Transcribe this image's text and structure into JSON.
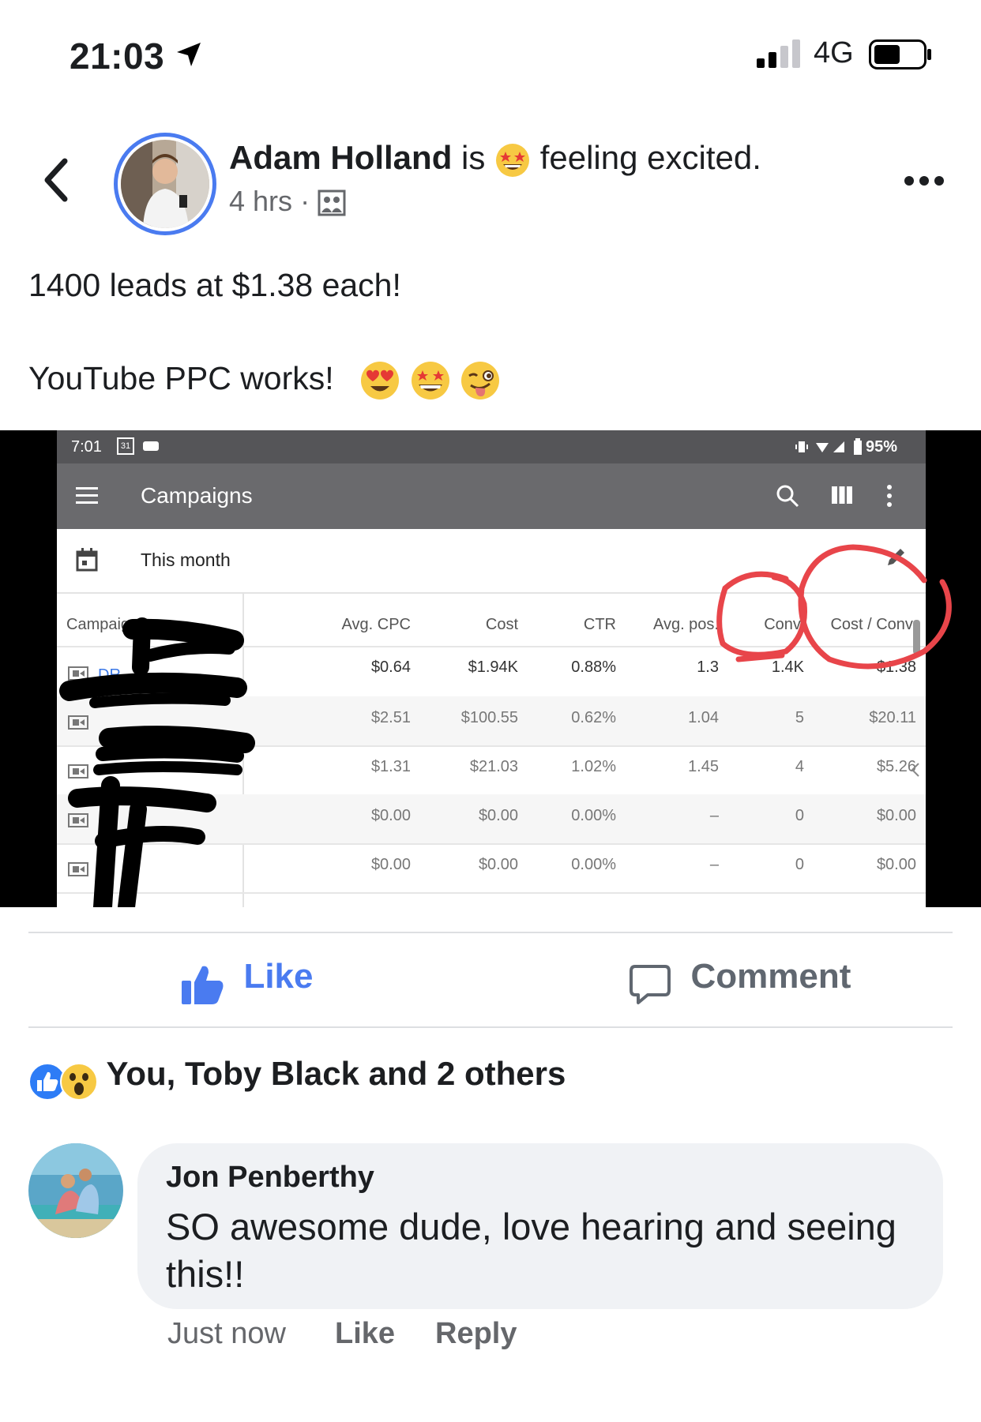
{
  "status_bar": {
    "time": "21:03",
    "network": "4G"
  },
  "post": {
    "author": "Adam Holland",
    "is": "is",
    "feeling": "feeling excited.",
    "time": "4 hrs",
    "separator": "·",
    "text_line1": "1400 leads at $1.38 each!",
    "text_line2": "YouTube PPC works!"
  },
  "embedded": {
    "status_time": "7:01",
    "calendar_day": "31",
    "battery": "95%",
    "toolbar_title": "Campaigns",
    "date_range": "This month",
    "headers": [
      "Campaign",
      "Avg. CPC",
      "Cost",
      "CTR",
      "Avg. pos.",
      "Conv.",
      "Cost / Conv."
    ],
    "rows": [
      {
        "campaign": "DR",
        "avg_cpc": "$0.64",
        "cost": "$1.94K",
        "ctr": "0.88%",
        "avg_pos": "1.3",
        "conv": "1.4K",
        "cost_conv": "$1.38"
      },
      {
        "campaign": "",
        "avg_cpc": "$2.51",
        "cost": "$100.55",
        "ctr": "0.62%",
        "avg_pos": "1.04",
        "conv": "5",
        "cost_conv": "$20.11"
      },
      {
        "campaign": "",
        "avg_cpc": "$1.31",
        "cost": "$21.03",
        "ctr": "1.02%",
        "avg_pos": "1.45",
        "conv": "4",
        "cost_conv": "$5.26"
      },
      {
        "campaign": "",
        "avg_cpc": "$0.00",
        "cost": "$0.00",
        "ctr": "0.00%",
        "avg_pos": "–",
        "conv": "0",
        "cost_conv": "$0.00"
      },
      {
        "campaign": "",
        "avg_cpc": "$0.00",
        "cost": "$0.00",
        "ctr": "0.00%",
        "avg_pos": "–",
        "conv": "0",
        "cost_conv": "$0.00"
      }
    ]
  },
  "actions": {
    "like": "Like",
    "comment": "Comment"
  },
  "reactions": {
    "text": "You, Toby Black and 2 others"
  },
  "comment": {
    "author": "Jon Penberthy",
    "text": "SO awesome dude, love hearing and seeing this!!",
    "time": "Just now",
    "like": "Like",
    "reply": "Reply"
  },
  "colors": {
    "accent": "#4a7bf0",
    "circle": "#e8454a",
    "redaction": "#000000"
  },
  "icons": [
    "location-arrow-icon",
    "signal-icon",
    "battery-icon",
    "back-chevron-icon",
    "more-dots-icon",
    "photo-audience-icon",
    "thumbs-up-icon",
    "comment-icon",
    "reaction-like-icon",
    "reaction-wow-icon"
  ]
}
